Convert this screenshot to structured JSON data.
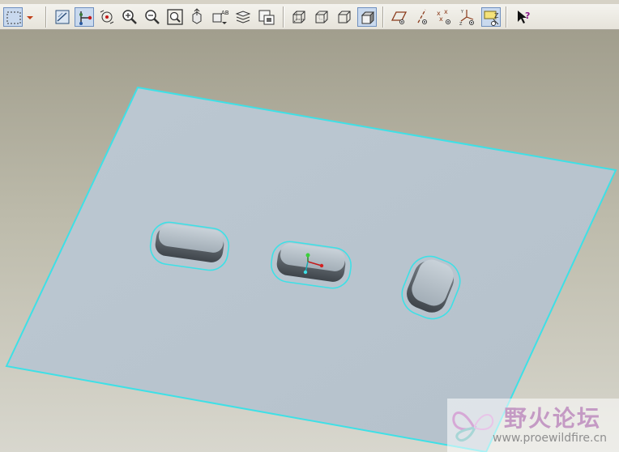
{
  "toolbar": {
    "buttons": [
      {
        "name": "select-box-icon",
        "active": false
      },
      {
        "name": "dropdown-arrow-icon",
        "active": false
      },
      {
        "name": "redraw-icon",
        "active": false
      },
      {
        "name": "spin-center-icon",
        "active": true
      },
      {
        "name": "orient-mode-icon",
        "active": false
      },
      {
        "name": "zoom-in-icon",
        "active": false
      },
      {
        "name": "zoom-out-icon",
        "active": false
      },
      {
        "name": "refit-icon",
        "active": false
      },
      {
        "name": "reorient-icon",
        "active": false
      },
      {
        "name": "saved-views-icon",
        "active": false
      },
      {
        "name": "layers-icon",
        "active": false
      },
      {
        "name": "view-manager-icon",
        "active": false
      },
      {
        "name": "wireframe-icon",
        "active": false
      },
      {
        "name": "hidden-line-icon",
        "active": false
      },
      {
        "name": "no-hidden-icon",
        "active": false
      },
      {
        "name": "shading-icon",
        "active": true
      },
      {
        "name": "datum-planes-icon",
        "active": false
      },
      {
        "name": "datum-axes-icon",
        "active": false
      },
      {
        "name": "datum-points-icon",
        "active": false
      },
      {
        "name": "coordinate-systems-icon",
        "active": false
      },
      {
        "name": "annotations-icon",
        "active": true
      },
      {
        "name": "whats-this-help-icon",
        "active": false
      }
    ]
  },
  "colors": {
    "background_top": "#a19e8d",
    "background_bottom": "#d8d7ce",
    "plate_fill": "#b9c6d0",
    "edge_highlight": "#3ee0e6"
  },
  "watermark": {
    "title": "野火论坛",
    "url": "www.proewildfire.cn"
  }
}
